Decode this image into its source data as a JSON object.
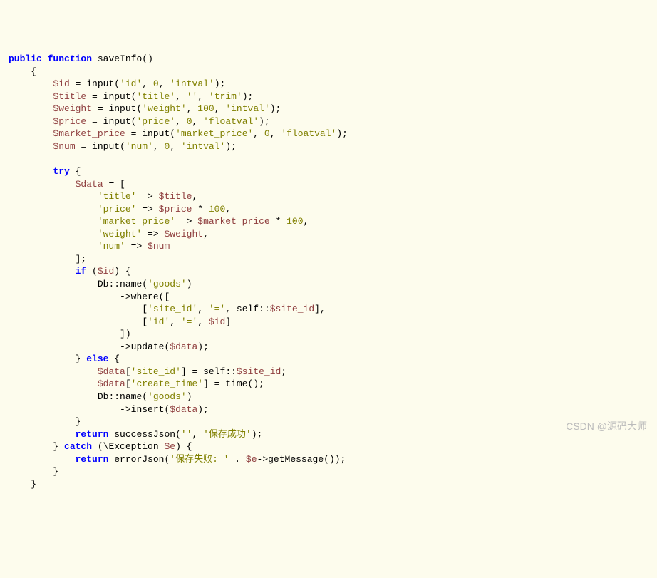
{
  "code": {
    "fn_decl": {
      "public": "public",
      "function": "function",
      "name": "saveInfo"
    },
    "vars": {
      "id": "$id",
      "title": "$title",
      "weight": "$weight",
      "price": "$price",
      "market_price": "$market_price",
      "num": "$num",
      "data": "$data",
      "e": "$e"
    },
    "calls": {
      "input": "input",
      "db": "Db",
      "name": "name",
      "where": "where",
      "update": "update",
      "insert": "insert",
      "time": "time",
      "successJson": "successJson",
      "errorJson": "errorJson",
      "getMessage": "getMessage",
      "self": "self",
      "site_id": "$site_id",
      "exception": "Exception"
    },
    "kw": {
      "try": "try",
      "if": "if",
      "else": "else",
      "catch": "catch",
      "return": "return"
    },
    "strings": {
      "id": "'id'",
      "title": "'title'",
      "weight": "'weight'",
      "price": "'price'",
      "market_price": "'market_price'",
      "num": "'num'",
      "empty": "''",
      "intval": "'intval'",
      "trim": "'trim'",
      "floatval": "'floatval'",
      "goods": "'goods'",
      "site_id": "'site_id'",
      "eq": "'='",
      "create_time": "'create_time'",
      "save_success": "'保存成功'",
      "save_fail": "'保存失败: '"
    },
    "nums": {
      "n0": "0",
      "n100": "100"
    }
  },
  "watermark": "CSDN @源码大师"
}
